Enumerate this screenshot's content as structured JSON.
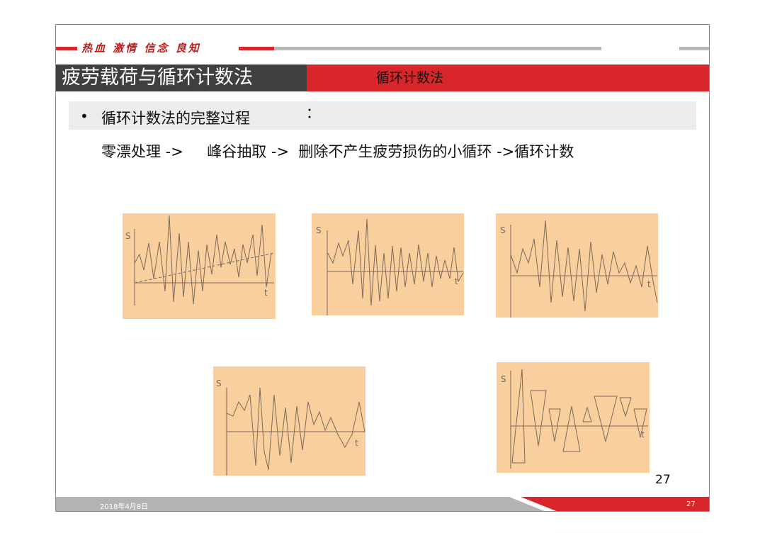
{
  "header": {
    "motto": "热血 激情 信念 良知",
    "title": "疲劳载荷与循环计数法",
    "subtitle": "循环计数法"
  },
  "bullet": {
    "text": "循环计数法的完整过程",
    "colon": "："
  },
  "process_text": "零漂处理 ->     峰谷抽取 ->  删除不产生疲劳损伤的小循环 ->循环计数",
  "figures": [
    {
      "name": "zero-drift",
      "s_label": "S",
      "t_label": "t"
    },
    {
      "name": "peak-valley",
      "s_label": "S",
      "t_label": "t"
    },
    {
      "name": "remove-small",
      "s_label": "S",
      "t_label": "t"
    },
    {
      "name": "cleaned",
      "s_label": "S",
      "t_label": "t"
    },
    {
      "name": "cycle-count",
      "s_label": "S",
      "t_label": "t"
    }
  ],
  "page_number": "27",
  "footer": {
    "date": "2018年4月8日",
    "page": "27"
  },
  "colors": {
    "accent_red": "#d8262b",
    "header_dark": "#3f3f3f",
    "figure_bg": "#f9cf9e"
  }
}
